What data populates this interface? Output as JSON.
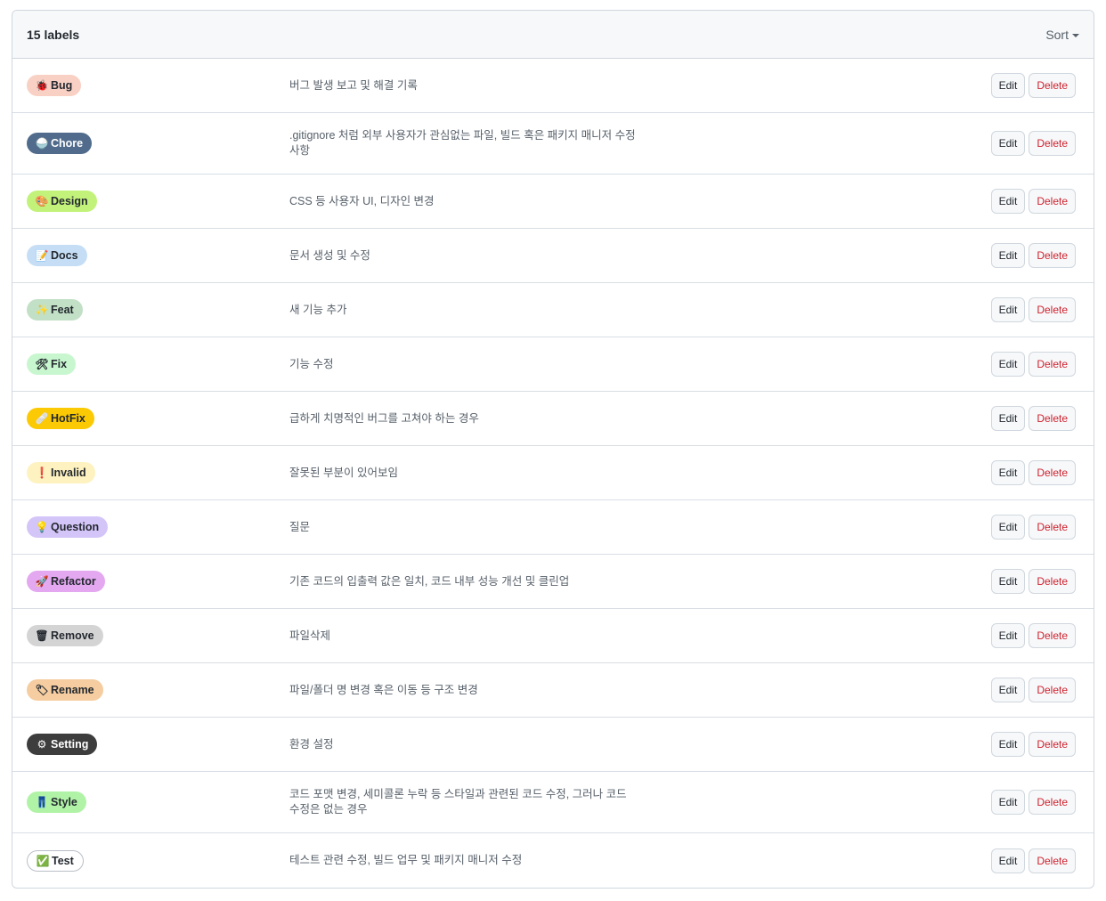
{
  "header": {
    "count_label": "15 labels",
    "sort_label": "Sort"
  },
  "actions": {
    "edit_label": "Edit",
    "delete_label": "Delete"
  },
  "labels": [
    {
      "name": "Bug",
      "icon": "🐞",
      "icon_name": "bug-icon",
      "bg": "#f9d0c4",
      "fg": "#24292f",
      "description": "버그 발생 보고 및 해결 기록"
    },
    {
      "name": "Chore",
      "icon": "🍚",
      "icon_name": "rice-icon",
      "bg": "#506b8b",
      "fg": "#ffffff",
      "description": ".gitignore 처럼 외부 사용자가 관심없는 파일, 빌드 혹은 패키지 매니저 수정 사항"
    },
    {
      "name": "Design",
      "icon": "🎨",
      "icon_name": "palette-icon",
      "bg": "#c2f27a",
      "fg": "#24292f",
      "description": "CSS 등 사용자 UI, 디자인 변경"
    },
    {
      "name": "Docs",
      "icon": "📝",
      "icon_name": "memo-icon",
      "bg": "#c5def5",
      "fg": "#24292f",
      "description": "문서 생성 및 수정"
    },
    {
      "name": "Feat",
      "icon": "✨",
      "icon_name": "sparkles-icon",
      "bg": "#c2e0c6",
      "fg": "#24292f",
      "description": "새 기능 추가"
    },
    {
      "name": "Fix",
      "icon": "🛠",
      "icon_name": "tools-icon",
      "bg": "#c8f7cf",
      "fg": "#24292f",
      "description": "기능 수정"
    },
    {
      "name": "HotFix",
      "icon": "🩹",
      "icon_name": "bandage-icon",
      "bg": "#fbca04",
      "fg": "#24292f",
      "description": "급하게 치명적인 버그를 고쳐야 하는 경우"
    },
    {
      "name": "Invalid",
      "icon": "❗",
      "icon_name": "exclamation-icon",
      "bg": "#fef2c0",
      "fg": "#24292f",
      "description": "잘못된 부분이 있어보임"
    },
    {
      "name": "Question",
      "icon": "💡",
      "icon_name": "lightbulb-icon",
      "bg": "#d4c5f9",
      "fg": "#24292f",
      "description": "질문"
    },
    {
      "name": "Refactor",
      "icon": "🚀",
      "icon_name": "rocket-icon",
      "bg": "#e3a8f0",
      "fg": "#24292f",
      "description": "기존 코드의 입출력 값은 일치, 코드 내부 성능 개선 및 클린업"
    },
    {
      "name": "Remove",
      "icon": "🗑",
      "icon_name": "trash-icon",
      "bg": "#d4d4d4",
      "fg": "#24292f",
      "description": "파일삭제"
    },
    {
      "name": "Rename",
      "icon": "🏷",
      "icon_name": "tag-icon",
      "bg": "#f5cda0",
      "fg": "#24292f",
      "description": "파일/폴더 명 변경 혹은 이동 등 구조 변경"
    },
    {
      "name": "Setting",
      "icon": "⚙",
      "icon_name": "gear-icon",
      "bg": "#3d3d3d",
      "fg": "#ffffff",
      "description": "환경 설정"
    },
    {
      "name": "Style",
      "icon": "👖",
      "icon_name": "jeans-icon",
      "bg": "#b1f3a6",
      "fg": "#24292f",
      "description": "코드 포맷 변경, 세미콜론 누락 등 스타일과 관련된 코드 수정, 그러나 코드 수정은 없는 경우"
    },
    {
      "name": "Test",
      "icon": "✅",
      "icon_name": "check-icon",
      "bg": "#ffffff",
      "fg": "#24292f",
      "description": "테스트 관련 수정, 빌드 업무 및 패키지 매니저 수정"
    }
  ]
}
